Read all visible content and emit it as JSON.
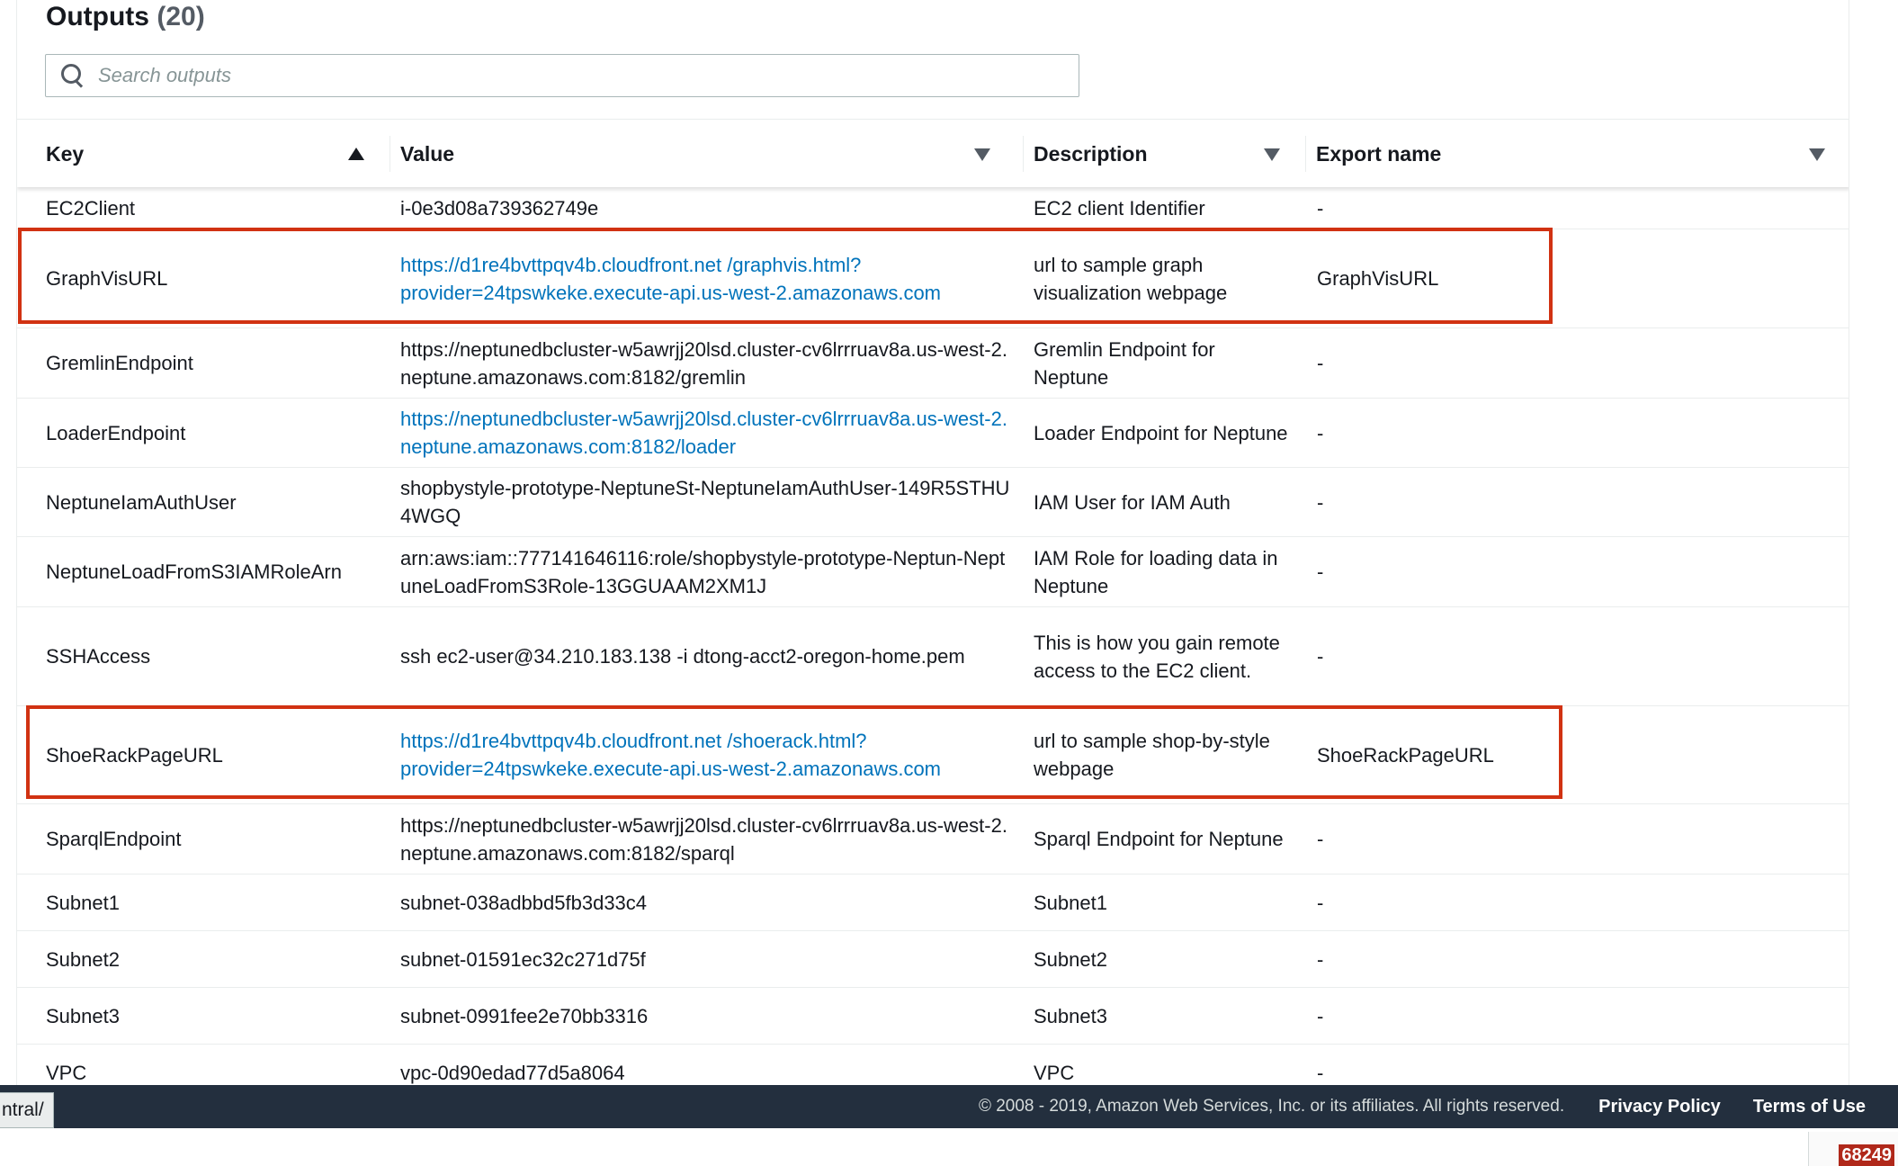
{
  "panel": {
    "title": "Outputs",
    "count": "(20)",
    "search_placeholder": "Search outputs"
  },
  "table": {
    "columns": {
      "key": "Key",
      "value": "Value",
      "description": "Description",
      "export_name": "Export name"
    },
    "sort": {
      "column": "Key",
      "direction": "ascending"
    },
    "rows": [
      {
        "key": "EC2Client",
        "value": "i-0e3d08a739362749e",
        "value_is_link": false,
        "description": "EC2 client Identifier",
        "export": "-",
        "highlighted": false
      },
      {
        "key": "GraphVisURL",
        "value": "https://d1re4bvttpqv4b.cloudfront.net /graphvis.html?provider=24tpswkeke.execute-api.us-west-2.amazonaws.com",
        "value_is_link": true,
        "description": "url to sample graph visualization webpage",
        "export": "GraphVisURL",
        "highlighted": true
      },
      {
        "key": "GremlinEndpoint",
        "value": "https://neptunedbcluster-w5awrjj20lsd.cluster-cv6lrrruav8a.us-west-2.neptune.amazonaws.com:8182/gremlin",
        "value_is_link": false,
        "description": "Gremlin Endpoint for Neptune",
        "export": "-",
        "highlighted": false
      },
      {
        "key": "LoaderEndpoint",
        "value": "https://neptunedbcluster-w5awrjj20lsd.cluster-cv6lrrruav8a.us-west-2.neptune.amazonaws.com:8182/loader",
        "value_is_link": true,
        "description": "Loader Endpoint for Neptune",
        "export": "-",
        "highlighted": false
      },
      {
        "key": "NeptuneIamAuthUser",
        "value": "shopbystyle-prototype-NeptuneSt-NeptuneIamAuthUser-149R5STHU4WGQ",
        "value_is_link": false,
        "description": "IAM User for IAM Auth",
        "export": "-",
        "highlighted": false
      },
      {
        "key": "NeptuneLoadFromS3IAMRoleArn",
        "value": "arn:aws:iam::777141646116:role/shopbystyle-prototype-Neptun-NeptuneLoadFromS3Role-13GGUAAM2XM1J",
        "value_is_link": false,
        "description": "IAM Role for loading data in Neptune",
        "export": "-",
        "highlighted": false
      },
      {
        "key": "SSHAccess",
        "value": "ssh ec2-user@34.210.183.138 -i dtong-acct2-oregon-home.pem",
        "value_is_link": false,
        "description": "This is how you gain remote access to the EC2 client.",
        "export": "-",
        "highlighted": false
      },
      {
        "key": "ShoeRackPageURL",
        "value": "https://d1re4bvttpqv4b.cloudfront.net /shoerack.html?provider=24tpswkeke.execute-api.us-west-2.amazonaws.com",
        "value_is_link": true,
        "description": "url to sample shop-by-style webpage",
        "export": "ShoeRackPageURL",
        "highlighted": true
      },
      {
        "key": "SparqlEndpoint",
        "value": "https://neptunedbcluster-w5awrjj20lsd.cluster-cv6lrrruav8a.us-west-2.neptune.amazonaws.com:8182/sparql",
        "value_is_link": false,
        "description": "Sparql Endpoint for Neptune",
        "export": "-",
        "highlighted": false
      },
      {
        "key": "Subnet1",
        "value": "subnet-038adbbd5fb3d33c4",
        "value_is_link": false,
        "description": "Subnet1",
        "export": "-",
        "highlighted": false
      },
      {
        "key": "Subnet2",
        "value": "subnet-01591ec32c271d75f",
        "value_is_link": false,
        "description": "Subnet2",
        "export": "-",
        "highlighted": false
      },
      {
        "key": "Subnet3",
        "value": "subnet-0991fee2e70bb3316",
        "value_is_link": false,
        "description": "Subnet3",
        "export": "-",
        "highlighted": false
      },
      {
        "key": "VPC",
        "value": "vpc-0d90edad77d5a8064",
        "value_is_link": false,
        "description": "VPC",
        "export": "-",
        "highlighted": false
      }
    ]
  },
  "footer": {
    "copyright": "© 2008 - 2019, Amazon Web Services, Inc. or its affiliates. All rights reserved.",
    "privacy": "Privacy Policy",
    "terms": "Terms of Use"
  },
  "status_bar_url": "ntral/",
  "corner_badge": "68249",
  "colors": {
    "link": "#0073bb",
    "highlight_border": "#d13212",
    "footer_bg": "#232f3e"
  }
}
